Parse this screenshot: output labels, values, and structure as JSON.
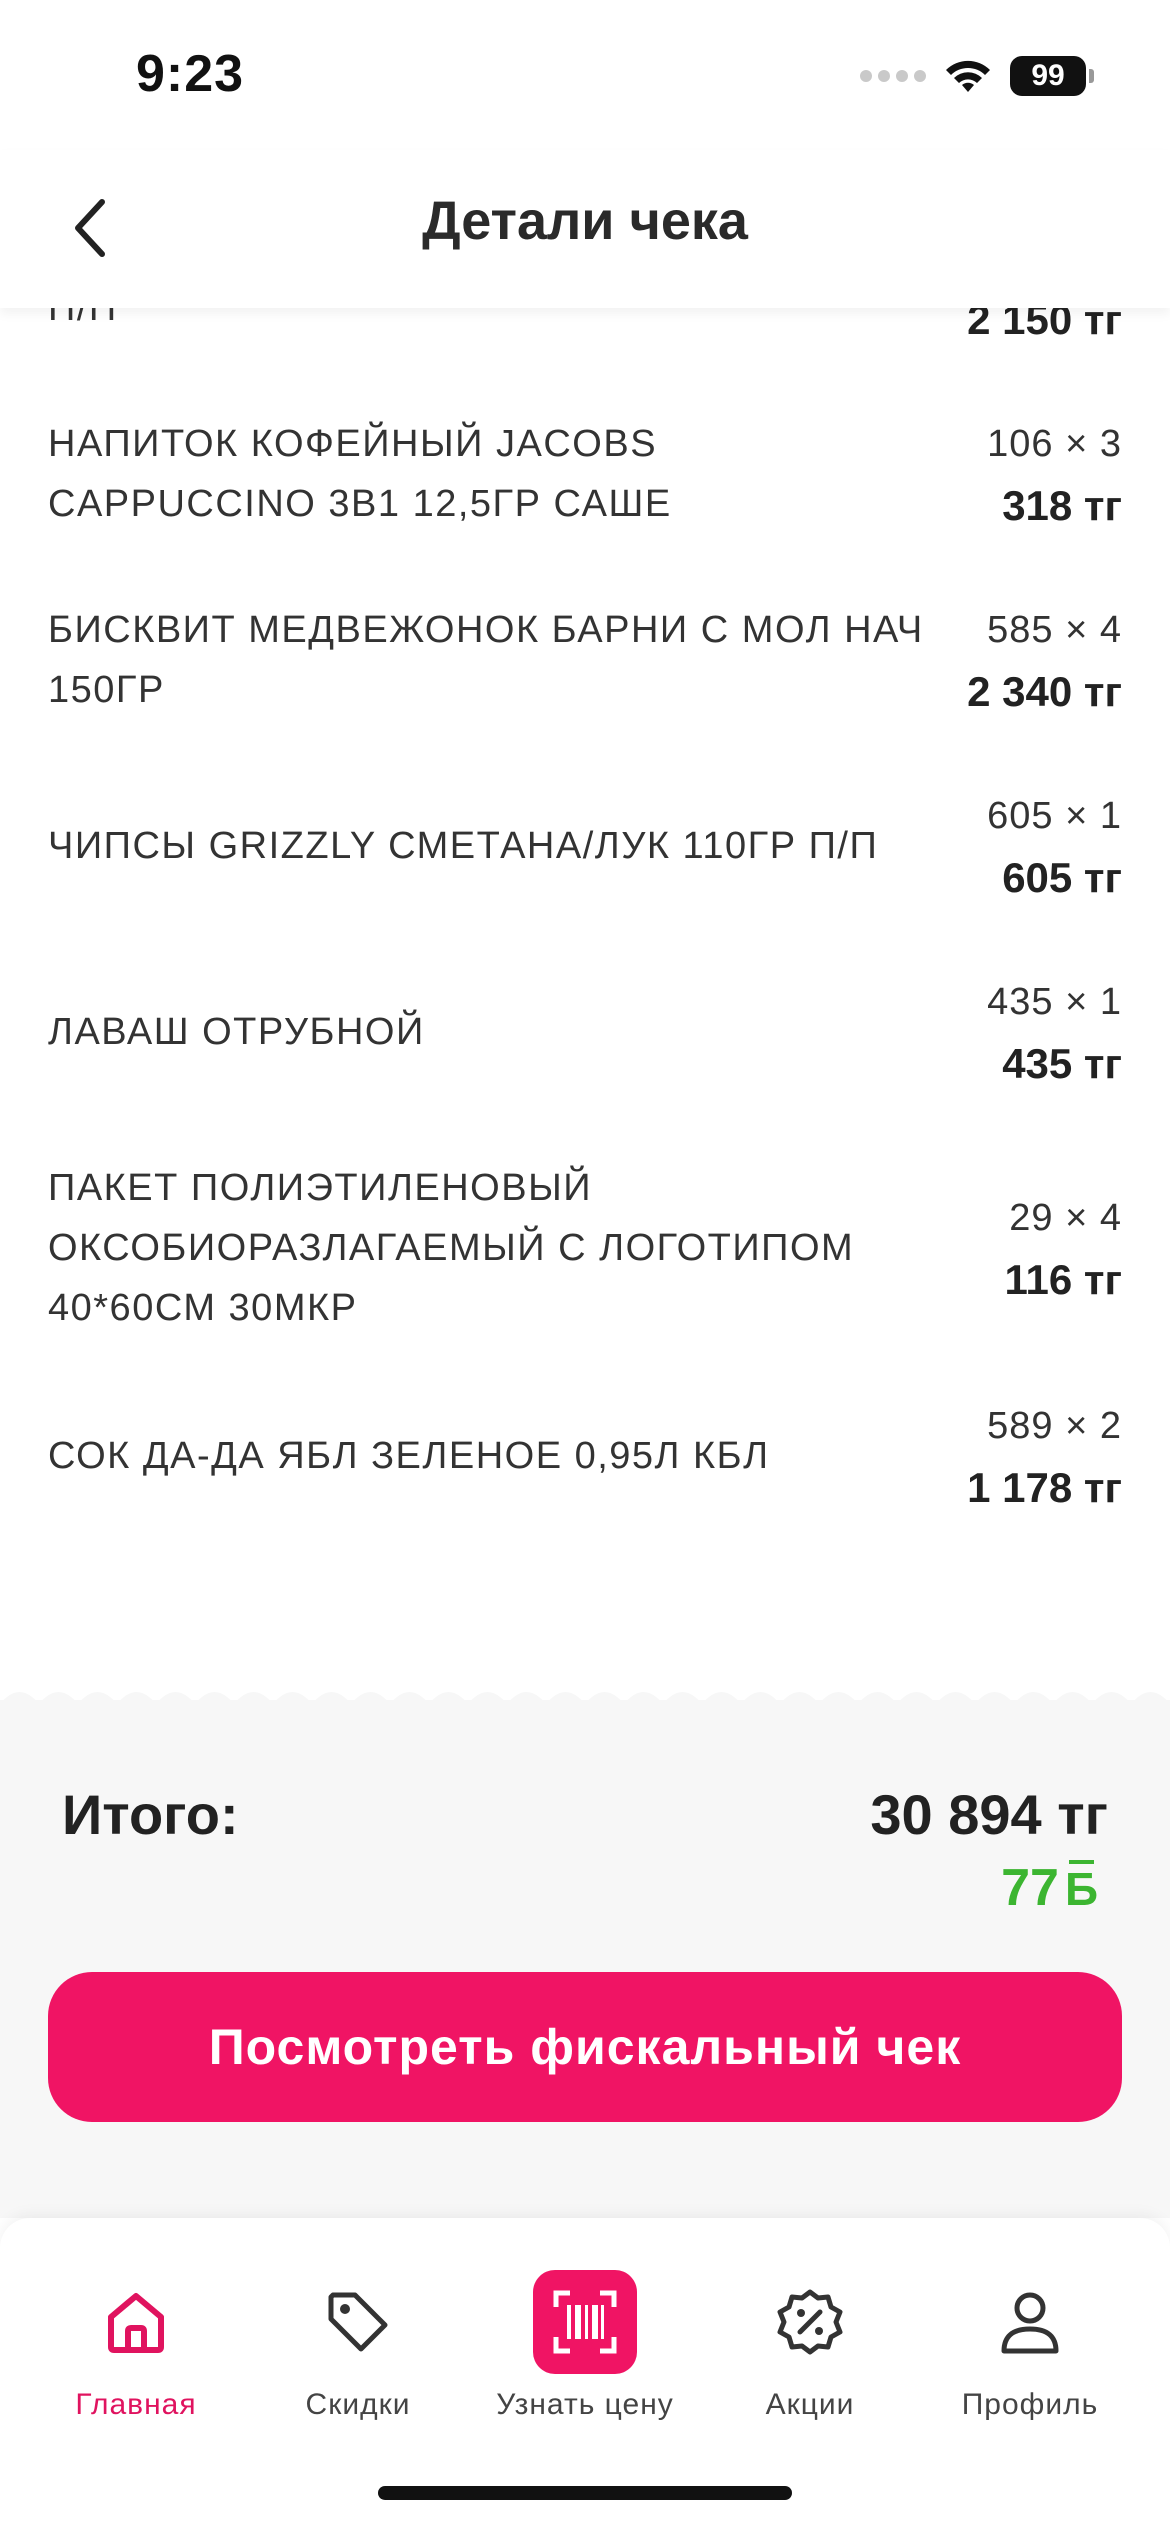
{
  "status_bar": {
    "time": "9:23",
    "battery": "99"
  },
  "header": {
    "title": "Детали чека"
  },
  "items": [
    {
      "name": "П/П",
      "qty": "",
      "total": "2 150 тг"
    },
    {
      "name": "НАПИТОК КОФЕЙНЫЙ JACOBS CAPPUCCINO 3В1 12,5ГР САШЕ",
      "qty": "106 × 3",
      "total": "318 тг"
    },
    {
      "name": "БИСКВИТ МЕДВЕЖОНОК БАРНИ С МОЛ НАЧ 150ГР",
      "qty": "585 × 4",
      "total": "2 340 тг"
    },
    {
      "name": "ЧИПСЫ GRIZZLY СМЕТАНА/ЛУК 110ГР П/П",
      "qty": "605 × 1",
      "total": "605 тг"
    },
    {
      "name": "ЛАВАШ ОТРУБНОЙ",
      "qty": "435 × 1",
      "total": "435 тг"
    },
    {
      "name": "ПАКЕТ ПОЛИЭТИЛЕНОВЫЙ ОКСОБИОРАЗЛАГАЕМЫЙ С ЛОГОТИПОМ 40*60СМ 30МКР",
      "qty": "29 × 4",
      "total": "116 тг"
    },
    {
      "name": "СОК ДА-ДА ЯБЛ ЗЕЛЕНОЕ 0,95Л КБЛ",
      "qty": "589 × 2",
      "total": "1 178 тг"
    }
  ],
  "summary": {
    "total_label": "Итого:",
    "total_value": "30 894 тг",
    "bonus_value": "77",
    "bonus_sign": "Б",
    "fiscal_button": "Посмотреть фискальный чек"
  },
  "tabbar": {
    "tabs": [
      {
        "label": "Главная",
        "icon": "home-icon",
        "active": true
      },
      {
        "label": "Скидки",
        "icon": "tag-icon",
        "active": false
      },
      {
        "label": "Узнать цену",
        "icon": "barcode-scan-icon",
        "active": false
      },
      {
        "label": "Акции",
        "icon": "percent-badge-icon",
        "active": false
      },
      {
        "label": "Профиль",
        "icon": "profile-icon",
        "active": false
      }
    ]
  },
  "colors": {
    "accent": "#f01464",
    "bonus": "#3cb531",
    "summary_bg": "#f7f7f7"
  }
}
